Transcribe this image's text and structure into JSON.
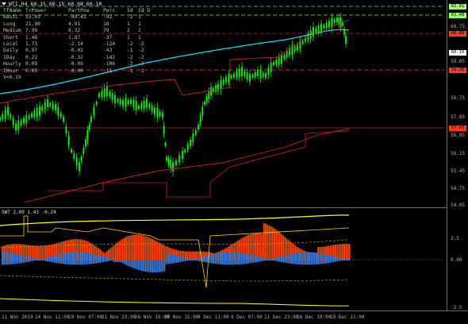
{
  "chart_header": {
    "symbol_line": "WTI,H4 60.15 60.15 60.08 60.10"
  },
  "strength_table": {
    "headers": [
      "TfName",
      "TrPower",
      "PartPow",
      "Perc.",
      "Id",
      "Id_D"
    ],
    "rows": [
      [
        "Basic",
        "53.43",
        "-49.42",
        "-92",
        "-2",
        "1"
      ],
      [
        "Long",
        "21.90",
        "4.91",
        "18",
        "1",
        "1"
      ],
      [
        "Medium",
        "7.99",
        "6.32",
        "79",
        "2",
        "2"
      ],
      [
        "Short",
        "1.48",
        "1.87",
        "-37",
        "1",
        "1"
      ],
      [
        "Local",
        "1.73",
        "-2.14",
        "-124",
        "-2",
        "-2"
      ],
      [
        "Daily",
        "0.97",
        "-0.42",
        "-43",
        "-1",
        "-2"
      ],
      [
        "IDay",
        "0.22",
        "-0.32",
        "-142",
        "-2",
        "-2"
      ],
      [
        "Hourly",
        "0.09",
        "-0.09",
        "-106",
        "-2",
        "-2"
      ],
      [
        "IHour",
        "0.05",
        "-0.00",
        "-11",
        "-1",
        "-1"
      ]
    ],
    "footer": "V=0.19"
  },
  "indicator_label": "SWT 2.09 1.43 -0.24",
  "price_axis": {
    "ticks": [
      "61.60",
      "60.75",
      "59.65",
      "58.75",
      "57.85",
      "56.95",
      "56.15",
      "55.45",
      "54.75",
      "54.05"
    ],
    "tags": [
      {
        "text": "61.81",
        "color": "#9cff6a"
      },
      {
        "text": "61.48",
        "color": "#9cff6a"
      },
      {
        "text": "60.88",
        "color": "#ff3b1f"
      },
      {
        "text": "60.10",
        "color": "#ffffff"
      },
      {
        "text": "59.38",
        "color": "#ff3b1f"
      },
      {
        "text": "57.03",
        "color": "#ff3b1f"
      }
    ]
  },
  "sub_axis": {
    "ticks": [
      "2.5",
      "0.00",
      "-2.5"
    ]
  },
  "time_axis": {
    "labels": [
      "11 Nov 2019",
      "14 Nov 11:00",
      "19 Nov 07:00",
      "21 Nov 23:00",
      "26 Nov 19:00",
      "29 Nov 15:00",
      "4 Dec 11:00",
      "9 Dec 07:00",
      "11 Dec 23:00",
      "16 Dec 19:00",
      "19 Dec 11:00"
    ]
  },
  "colors": {
    "candle_up": "#00ff00",
    "cyan_line": "#00e5ff",
    "red_line": "#d21e1e",
    "yellow_line": "#ffff00",
    "orange_hist": "#ff4500",
    "blue_hist": "#3b7bd6",
    "green_dash": "#66ff33"
  }
}
